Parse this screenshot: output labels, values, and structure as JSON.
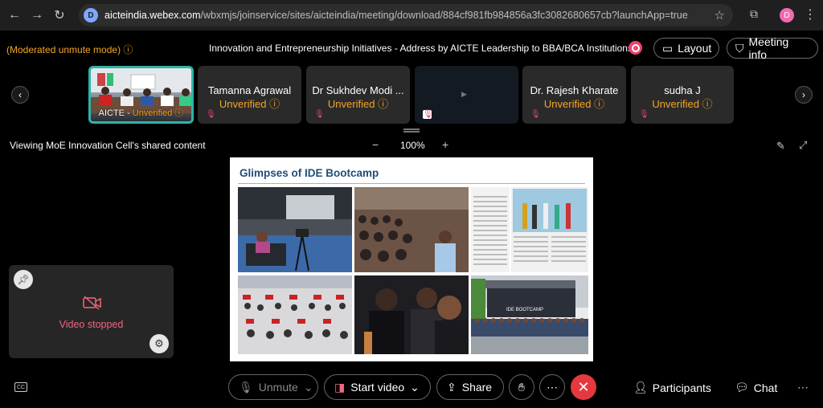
{
  "browser": {
    "url_host": "aicteindia.webex.com",
    "url_path": "/wbxmjs/joinservice/sites/aicteindia/meeting/download/884cf981fb984856a3fc3082680657cb?launchApp=true",
    "site_icon_letter": "D",
    "profile_letter": "D"
  },
  "meeting": {
    "mode_label": "(Moderated unmute mode)",
    "title": "Innovation and Entrepreneurship Initiatives - Address by AICTE Leadership to BBA/BCA Institutions.",
    "layout_label": "Layout",
    "info_label": "Meeting info"
  },
  "participants": [
    {
      "name": "AICTE",
      "status": "Unverified"
    },
    {
      "name": "Tamanna Agrawal",
      "status": "Unverified"
    },
    {
      "name": "Dr Sukhdev Modi ...",
      "status": "Unverified"
    },
    {
      "name": "",
      "status": ""
    },
    {
      "name": "Dr. Rajesh Kharate",
      "status": "Unverified"
    },
    {
      "name": "sudha J",
      "status": "Unverified"
    }
  ],
  "share": {
    "viewing_label": "Viewing MoE Innovation Cell's shared content",
    "zoom": "100%",
    "zoom_minus": "−",
    "zoom_plus": "+"
  },
  "slide": {
    "title": "Glimpses of IDE Bootcamp",
    "banner_text": "IDE BOOTCAMP"
  },
  "selfview": {
    "status_label": "Video stopped"
  },
  "controls": {
    "unmute_label": "Unmute",
    "start_video_label": "Start video",
    "share_label": "Share",
    "participants_label": "Participants",
    "chat_label": "Chat"
  },
  "colors": {
    "warning": "#f5a623",
    "leave": "#e5393f",
    "active_border": "#2fb3a8"
  }
}
